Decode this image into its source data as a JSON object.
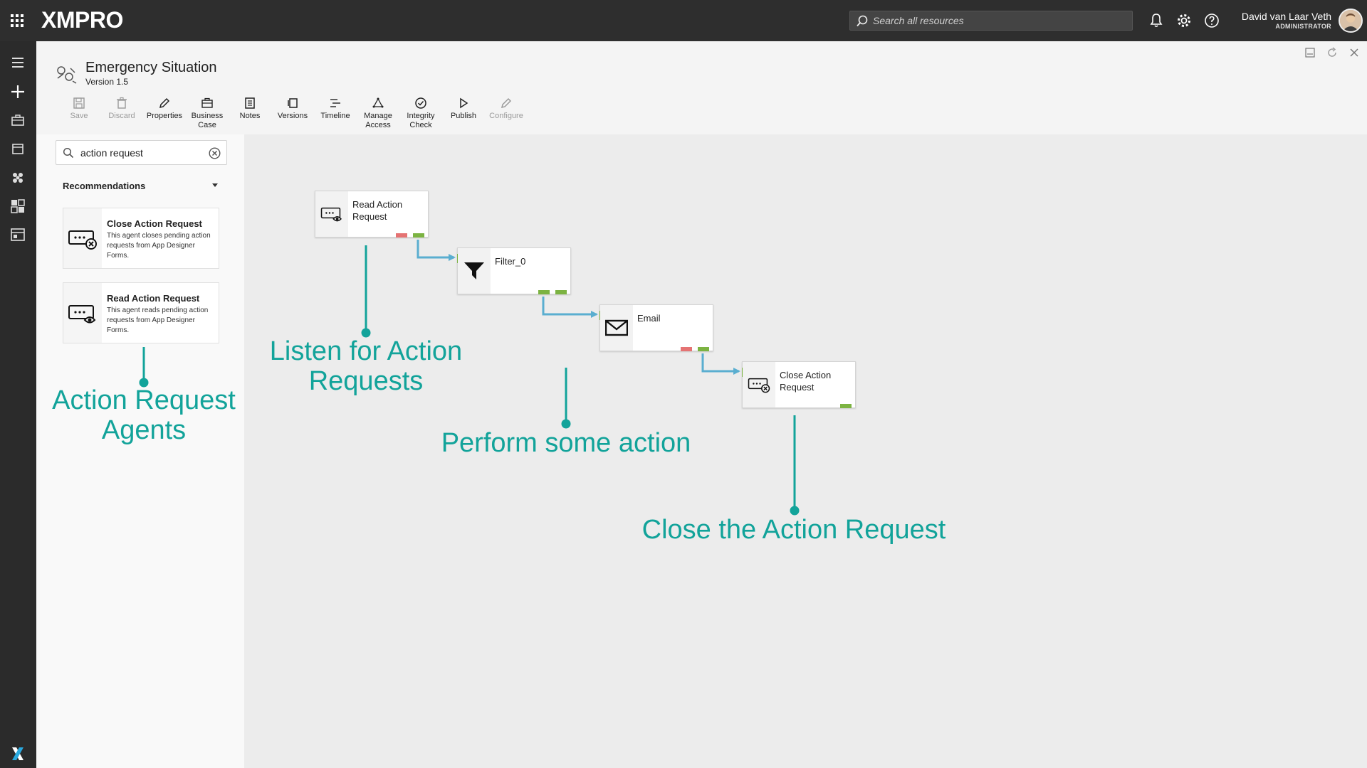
{
  "topbar": {
    "logo": "XMPRO",
    "search_placeholder": "Search all resources",
    "user_name": "David van Laar Veth",
    "user_role": "ADMINISTRATOR"
  },
  "header": {
    "title": "Emergency Situation",
    "version": "Version 1.5",
    "toolbar": [
      {
        "label": "Save",
        "icon": "save-icon",
        "enabled": false
      },
      {
        "label": "Discard",
        "icon": "trash-icon",
        "enabled": false
      },
      {
        "label": "Properties",
        "icon": "pencil-icon",
        "enabled": true
      },
      {
        "label": "Business Case",
        "icon": "briefcase-icon",
        "enabled": true
      },
      {
        "label": "Notes",
        "icon": "notes-icon",
        "enabled": true
      },
      {
        "label": "Versions",
        "icon": "versions-icon",
        "enabled": true
      },
      {
        "label": "Timeline",
        "icon": "timeline-icon",
        "enabled": true
      },
      {
        "label": "Manage Access",
        "icon": "access-icon",
        "enabled": true
      },
      {
        "label": "Integrity Check",
        "icon": "check-circle-icon",
        "enabled": true
      },
      {
        "label": "Publish",
        "icon": "play-icon",
        "enabled": true
      },
      {
        "label": "Configure",
        "icon": "pencil-icon",
        "enabled": false
      }
    ]
  },
  "sidepanel": {
    "search_value": "action request",
    "recommendations_label": "Recommendations",
    "agents": [
      {
        "title": "Close Action Request",
        "description": "This agent closes pending action requests from App Designer Forms.",
        "icon": "close-action-request-icon"
      },
      {
        "title": "Read Action Request",
        "description": "This agent reads pending action requests from App Designer Forms.",
        "icon": "read-action-request-icon"
      }
    ]
  },
  "canvas": {
    "nodes": [
      {
        "label": "Read Action Request",
        "icon": "read-action-request-icon"
      },
      {
        "label": "Filter_0",
        "icon": "filter-icon"
      },
      {
        "label": "Email",
        "icon": "envelope-icon"
      },
      {
        "label": "Close Action Request",
        "icon": "close-action-request-icon"
      }
    ],
    "annotations": {
      "agents": "Action Request Agents",
      "listen": "Listen for Action Requests",
      "perform": "Perform some action",
      "close": "Close the Action Request"
    }
  },
  "colors": {
    "annotation": "#12a39a",
    "connector": "#5aaed0",
    "port_success": "#7cb342",
    "port_error": "#e57373"
  }
}
